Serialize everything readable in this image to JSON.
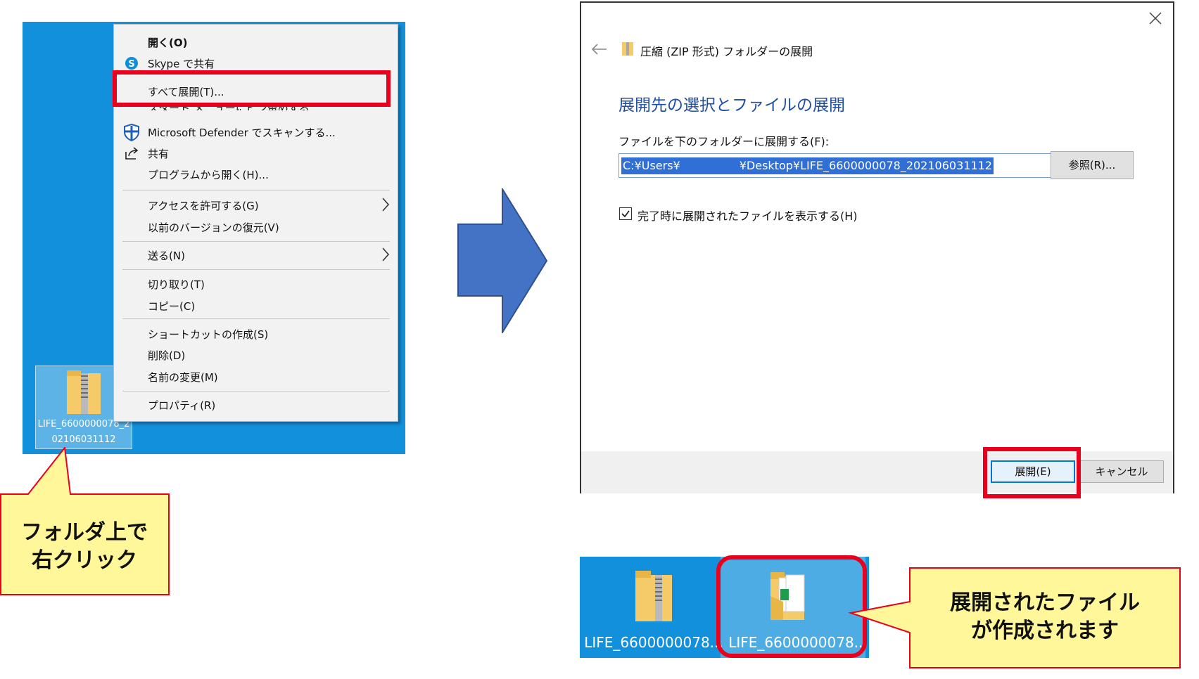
{
  "context_menu": {
    "items": [
      {
        "label": "開く(O)",
        "bold": true
      },
      {
        "label": "Skype で共有",
        "icon": "skype-icon"
      },
      {
        "label": "すべて展開(T)..."
      },
      {
        "label": "スタート メニューにピン留めする"
      },
      {
        "label": "Microsoft Defender でスキャンする...",
        "icon": "defender-shield-icon"
      },
      {
        "label": "共有",
        "icon": "share-icon"
      },
      {
        "label": "プログラムから開く(H)..."
      },
      {
        "label": "アクセスを許可する(G)",
        "submenu": true
      },
      {
        "label": "以前のバージョンの復元(V)"
      },
      {
        "label": "送る(N)",
        "submenu": true
      },
      {
        "label": "切り取り(T)"
      },
      {
        "label": "コピー(C)"
      },
      {
        "label": "ショートカットの作成(S)"
      },
      {
        "label": "削除(D)"
      },
      {
        "label": "名前の変更(M)"
      },
      {
        "label": "プロパティ(R)"
      }
    ]
  },
  "desktop_file": {
    "label": "LIFE_6600000078_202106031112"
  },
  "callout_left": {
    "line1": "フォルダ上で",
    "line2": "右クリック"
  },
  "dialog": {
    "title": "圧縮 (ZIP 形式) フォルダーの展開",
    "heading": "展開先の選択とファイルの展開",
    "field_label": "ファイルを下のフォルダーに展開する(F):",
    "path_prefix": "C:¥Users¥",
    "path_suffix": "¥Desktop¥LIFE_6600000078_202106031112",
    "browse_label": "参照(R)...",
    "checkbox_label": "完了時に展開されたファイルを表示する(H)",
    "checkbox_checked": true,
    "extract_label": "展開(E)",
    "cancel_label": "キャンセル"
  },
  "result_desktop": {
    "zip_label": "LIFE_6600000078...",
    "folder_label": "LIFE_6600000078..."
  },
  "callout_right": {
    "line1": "展開されたファイル",
    "line2": "が作成されます"
  },
  "colors": {
    "desktop": "#1390db",
    "highlight": "#e8001c",
    "callout": "#fff79a",
    "arrow": "#4472c4",
    "heading": "#1e4fa3"
  }
}
